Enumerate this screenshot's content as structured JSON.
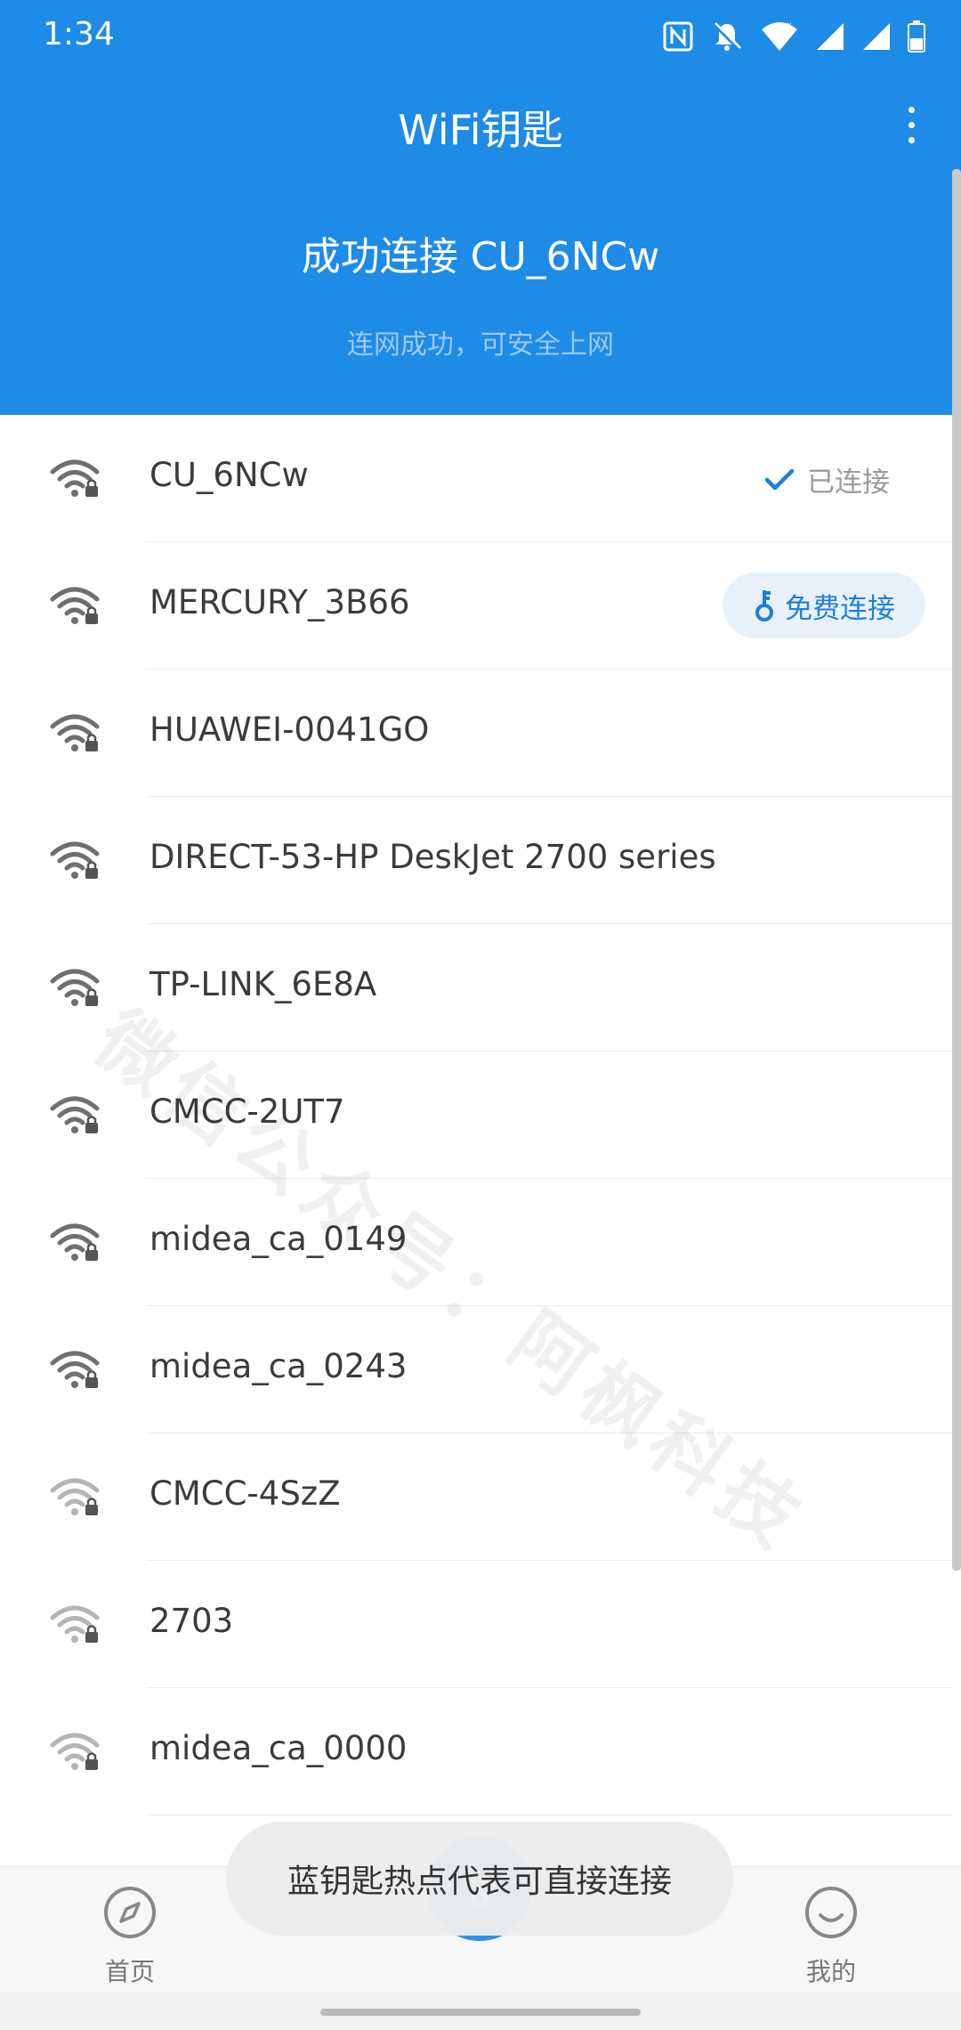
{
  "status_bar": {
    "time": "1:34"
  },
  "app_bar": {
    "title": "WiFi钥匙"
  },
  "connection": {
    "title": "成功连接 CU_6NCw",
    "subtitle": "连网成功，可安全上网"
  },
  "networks": [
    {
      "name": "CU_6NCw",
      "signal": "full",
      "status_label": "已连接"
    },
    {
      "name": "MERCURY_3B66",
      "signal": "full",
      "action_label": "免费连接"
    },
    {
      "name": "HUAWEI-0041GO",
      "signal": "full"
    },
    {
      "name": "DIRECT-53-HP DeskJet 2700 series",
      "signal": "full"
    },
    {
      "name": "TP-LINK_6E8A",
      "signal": "full"
    },
    {
      "name": "CMCC-2UT7",
      "signal": "full"
    },
    {
      "name": "midea_ca_0149",
      "signal": "full"
    },
    {
      "name": "midea_ca_0243",
      "signal": "full"
    },
    {
      "name": "CMCC-4SzZ",
      "signal": "weak"
    },
    {
      "name": "2703",
      "signal": "weak"
    },
    {
      "name": "midea_ca_0000",
      "signal": "weak"
    }
  ],
  "watermark": "微信公众号：阿枫科技",
  "bottom_nav": {
    "home_label": "首页",
    "mine_label": "我的"
  },
  "toast": {
    "text": "蓝钥匙热点代表可直接连接"
  },
  "colors": {
    "primary": "#1e8be6",
    "accent_text": "#1e7fd8"
  },
  "icons": {
    "wifi": "wifi-lock-icon",
    "connected": "checkmark-icon",
    "free_connect": "key-icon",
    "home": "compass-icon",
    "mine": "smiley-icon"
  }
}
